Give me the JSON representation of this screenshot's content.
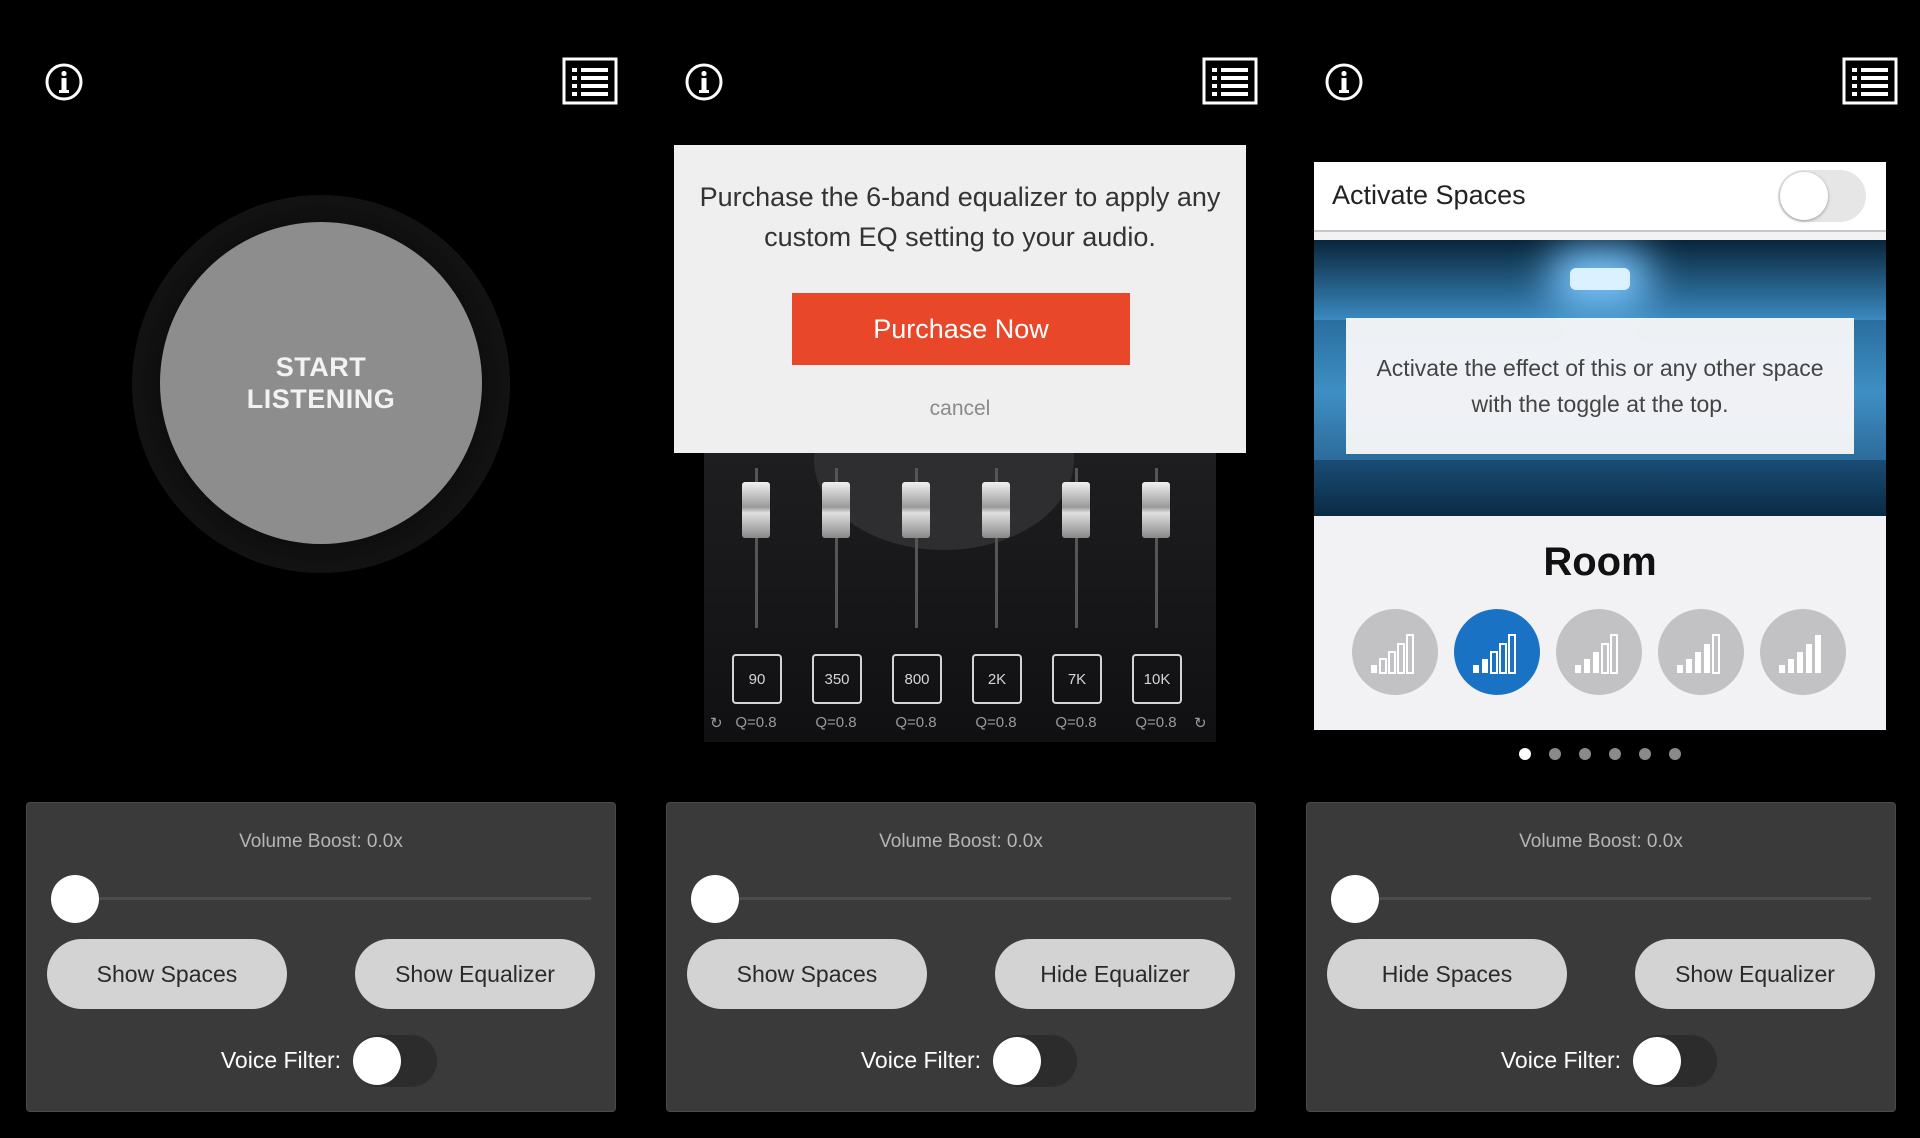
{
  "panel1": {
    "start_label": "START\nLISTENING",
    "volume_label": "Volume Boost: 0.0x",
    "left_button": "Show Spaces",
    "right_button": "Show Equalizer",
    "voice_filter_label": "Voice Filter:",
    "volume_boost_value": 0.0,
    "voice_filter_on": false
  },
  "panel2": {
    "dialog_message": "Purchase the 6-band equalizer to apply any custom EQ setting to your audio.",
    "purchase_button": "Purchase Now",
    "cancel_link": "cancel",
    "eq_bands": [
      {
        "freq": "90",
        "q": "Q=0.8"
      },
      {
        "freq": "350",
        "q": "Q=0.8"
      },
      {
        "freq": "800",
        "q": "Q=0.8"
      },
      {
        "freq": "2K",
        "q": "Q=0.8"
      },
      {
        "freq": "7K",
        "q": "Q=0.8"
      },
      {
        "freq": "10K",
        "q": "Q=0.8"
      }
    ],
    "volume_label": "Volume Boost: 0.0x",
    "left_button": "Show Spaces",
    "right_button": "Hide Equalizer",
    "voice_filter_label": "Voice Filter:",
    "reset_icon": "refresh-icon",
    "colors": {
      "purchase": "#e8472a"
    }
  },
  "panel3": {
    "activate_label": "Activate Spaces",
    "activate_on": false,
    "tip_text": "Activate the effect of this or any other space with the toggle at the top.",
    "room_name": "Room",
    "room_levels": [
      1,
      2,
      3,
      4,
      5
    ],
    "room_selected_index": 1,
    "page_count": 6,
    "page_active": 0,
    "volume_label": "Volume Boost: 0.0x",
    "left_button": "Hide Spaces",
    "right_button": "Show Equalizer",
    "voice_filter_label": "Voice Filter:",
    "colors": {
      "room_active": "#1a72c4"
    }
  },
  "icons": {
    "info": "info-icon",
    "menu": "list-menu-icon"
  }
}
